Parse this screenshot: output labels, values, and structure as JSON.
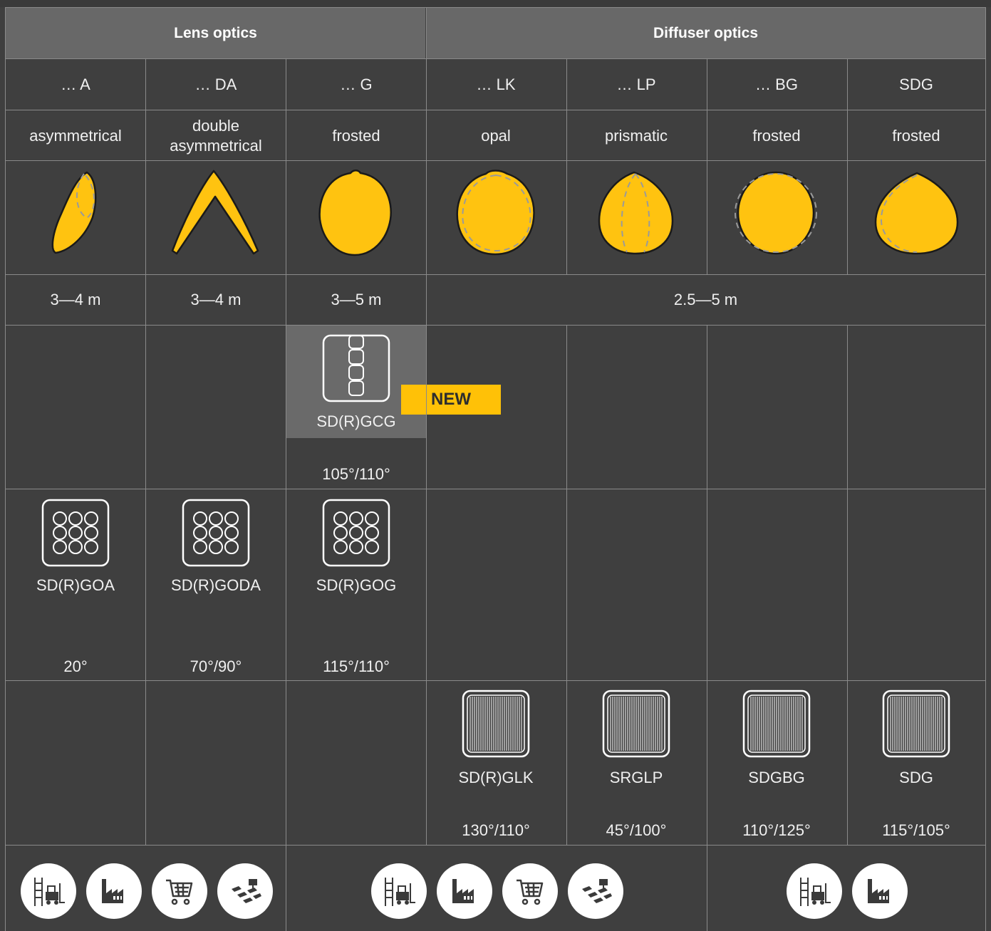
{
  "headers": {
    "lens": "Lens optics",
    "diffuser": "Diffuser optics"
  },
  "columns": [
    {
      "code": "… A",
      "type": "asymmetrical"
    },
    {
      "code": "… DA",
      "type": "double asymmetrical"
    },
    {
      "code": "… G",
      "type": "frosted"
    },
    {
      "code": "… LK",
      "type": "opal"
    },
    {
      "code": "… LP",
      "type": "prismatic"
    },
    {
      "code": "… BG",
      "type": "frosted"
    },
    {
      "code": "SDG",
      "type": "frosted"
    }
  ],
  "heights": {
    "a": "3—4 m",
    "da": "3—4 m",
    "g": "3—5 m",
    "diffuser": "2.5—5 m"
  },
  "rows": {
    "linear": {
      "g": {
        "name": "SD(R)GCG",
        "angle": "105°/110°"
      }
    },
    "lens": {
      "a": {
        "name": "SD(R)GOA",
        "angle": "20°"
      },
      "da": {
        "name": "SD(R)GODA",
        "angle": "70°/90°"
      },
      "g": {
        "name": "SD(R)GOG",
        "angle": "115°/110°"
      }
    },
    "diffuser": {
      "lk": {
        "name": "SD(R)GLK",
        "angle": "130°/110°"
      },
      "lp": {
        "name": "SRGLP",
        "angle": "45°/100°"
      },
      "bg": {
        "name": "SDGBG",
        "angle": "110°/125°"
      },
      "sdg": {
        "name": "SDG",
        "angle": "115°/105°"
      }
    }
  },
  "badge": "NEW",
  "applications": {
    "group1": [
      "warehouse-icon",
      "factory-icon",
      "shopping-cart-icon",
      "office-icon"
    ],
    "group2": [
      "warehouse-icon",
      "factory-icon",
      "shopping-cart-icon",
      "office-icon"
    ],
    "group3": [
      "warehouse-icon",
      "factory-icon"
    ]
  },
  "colors": {
    "accent": "#ffc107",
    "background": "#3f3f3f",
    "header": "#686868",
    "highlight": "#6a6a6a",
    "icon_bg": "#ffffff"
  }
}
